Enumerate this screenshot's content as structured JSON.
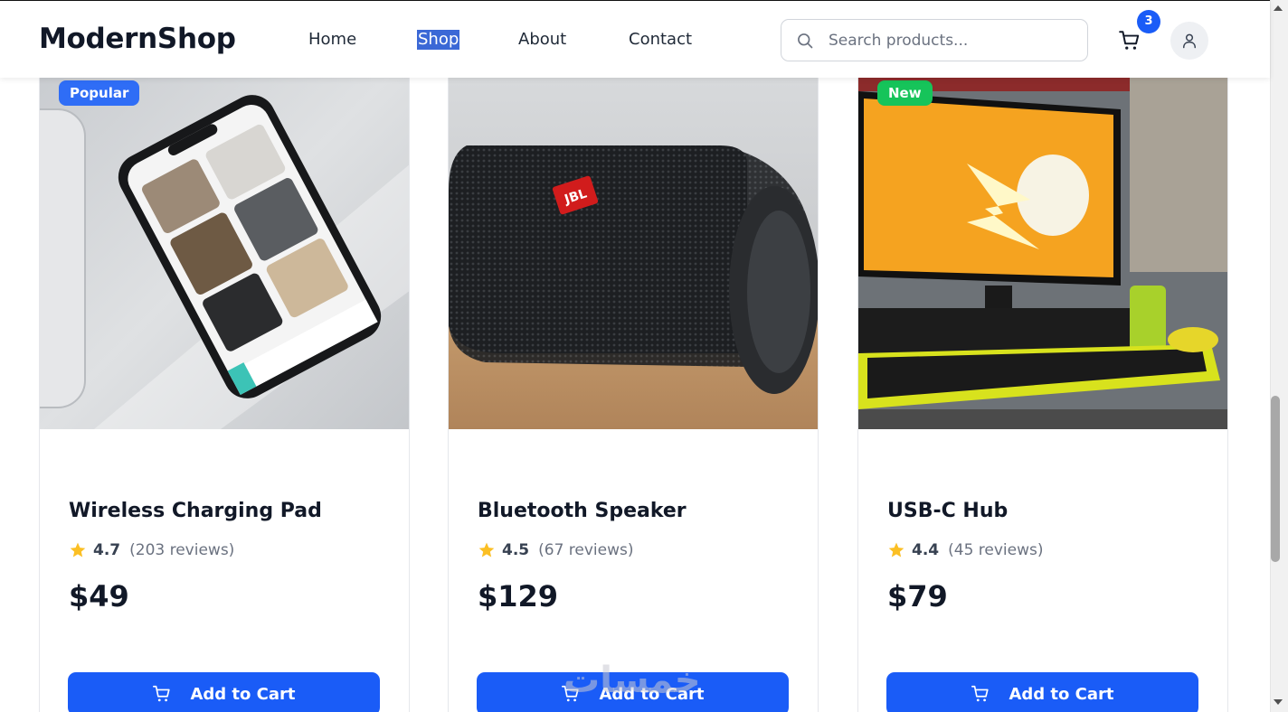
{
  "header": {
    "logo": "ModernShop",
    "nav": [
      {
        "label": "Home"
      },
      {
        "label": "Shop",
        "selected": true
      },
      {
        "label": "About"
      },
      {
        "label": "Contact"
      }
    ],
    "search": {
      "placeholder": "Search products...",
      "icon": "search-icon"
    },
    "cart": {
      "icon": "cart-icon",
      "count": "3"
    },
    "account": {
      "icon": "user-icon"
    }
  },
  "products": [
    {
      "badge": "Popular",
      "badge_color": "#2f6df6",
      "image": "smartphone-on-desk-photo",
      "title": "Wireless Charging Pad",
      "rating": "4.7",
      "reviews": "(203 reviews)",
      "price": "$49",
      "button": "Add to Cart"
    },
    {
      "badge": "",
      "image": "jbl-bluetooth-speaker-photo",
      "title": "Bluetooth Speaker",
      "rating": "4.5",
      "reviews": "(67 reviews)",
      "price": "$129",
      "button": "Add to Cart"
    },
    {
      "badge": "New",
      "badge_color": "#16c45a",
      "image": "desk-monitor-keyboard-photo",
      "title": "USB-C Hub",
      "rating": "4.4",
      "reviews": "(45 reviews)",
      "price": "$79",
      "button": "Add to Cart"
    }
  ],
  "watermark": "خمسات",
  "colors": {
    "accent": "#1a5cf7",
    "star": "#fbbf24",
    "nav_selected_bg": "#3b68d6"
  }
}
